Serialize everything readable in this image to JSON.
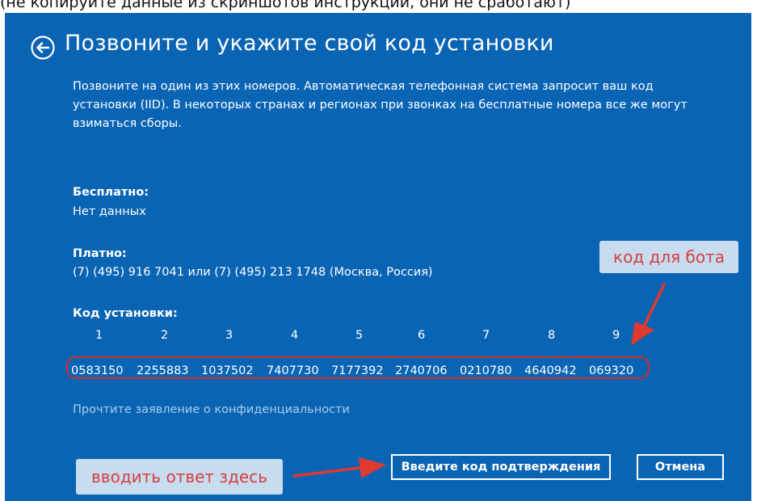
{
  "caption": "(не копируйте данные из скриншотов инструкций, они не сработают)",
  "title": "Позвоните и укажите свой код установки",
  "intro": "Позвоните на один из этих номеров. Автоматическая телефонная система запросит ваш код установки (IID). В некоторых странах и регионах при звонках на бесплатные номера все же могут взиматься сборы.",
  "free": {
    "label": "Бесплатно:",
    "value": "Нет данных"
  },
  "paid": {
    "label": "Платно:",
    "value": "(7) (495) 916 7041 или (7) (495) 213 1748 (Москва, Россия)"
  },
  "install_code": {
    "label": "Код установки:",
    "group_numbers": [
      "1",
      "2",
      "3",
      "4",
      "5",
      "6",
      "7",
      "8",
      "9"
    ],
    "groups": [
      "0583150",
      "2255883",
      "1037502",
      "7407730",
      "7177392",
      "2740706",
      "0210780",
      "4640942",
      "069320"
    ]
  },
  "privacy_link": "Прочтите заявление о конфиденциальности",
  "buttons": {
    "confirm": "Введите код подтверждения",
    "cancel": "Отмена"
  },
  "annotations": {
    "bot_code": "код для бота",
    "enter_answer": "вводить ответ здесь"
  },
  "colors": {
    "panel": "#0a64b4",
    "callout_bg": "#c7dcef",
    "callout_text": "#d64040",
    "highlight": "#d42a2a",
    "link": "#a6cdf0"
  },
  "icons": {
    "back": "back-arrow-circle-icon"
  }
}
